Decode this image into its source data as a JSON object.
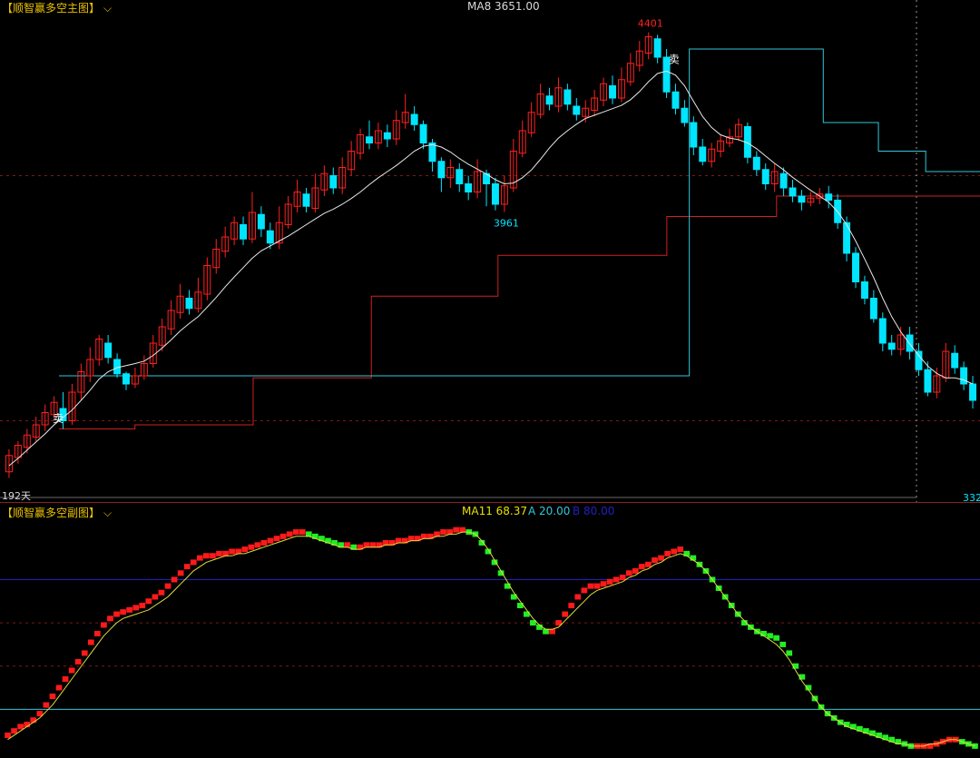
{
  "main": {
    "title": "【顺智赢多空主图】",
    "ma_label": "MA8 3651.00",
    "days_label": "192天",
    "price_high": "4401",
    "price_low": "3961",
    "price_right": "332",
    "sell_marker": "卖"
  },
  "sub": {
    "title": "【顺智赢多空副图】",
    "ma_label": "MA11 68.37",
    "a_label": "A 20.00",
    "b_label": "B 80.00"
  },
  "colors": {
    "up": "#ff2020",
    "down": "#00e5ff",
    "ma": "#e8e8e8",
    "step_red": "#d02020",
    "step_cyan": "#30c8d8",
    "osc_up": "#ff1a1a",
    "osc_down": "#22ee22",
    "osc_ma": "#dcdc40",
    "level_a": "#30c8d8",
    "level_b": "#2020c0",
    "title": "#e8c000"
  },
  "chart_data": [
    {
      "type": "candlestick",
      "ylim": [
        3280,
        4440
      ],
      "candles": [
        [
          3325,
          3365,
          3310,
          3380
        ],
        [
          3360,
          3390,
          3345,
          3400
        ],
        [
          3385,
          3415,
          3370,
          3430
        ],
        [
          3410,
          3440,
          3400,
          3460
        ],
        [
          3440,
          3470,
          3425,
          3490
        ],
        [
          3465,
          3495,
          3455,
          3510
        ],
        [
          3480,
          3450,
          3430,
          3520
        ],
        [
          3450,
          3520,
          3440,
          3540
        ],
        [
          3520,
          3570,
          3500,
          3590
        ],
        [
          3560,
          3600,
          3545,
          3630
        ],
        [
          3600,
          3650,
          3585,
          3660
        ],
        [
          3640,
          3605,
          3590,
          3660
        ],
        [
          3600,
          3565,
          3555,
          3615
        ],
        [
          3565,
          3540,
          3525,
          3570
        ],
        [
          3540,
          3560,
          3530,
          3580
        ],
        [
          3560,
          3590,
          3550,
          3610
        ],
        [
          3590,
          3640,
          3580,
          3660
        ],
        [
          3635,
          3680,
          3620,
          3700
        ],
        [
          3675,
          3720,
          3660,
          3745
        ],
        [
          3715,
          3755,
          3700,
          3785
        ],
        [
          3750,
          3725,
          3710,
          3770
        ],
        [
          3725,
          3765,
          3715,
          3800
        ],
        [
          3760,
          3830,
          3745,
          3850
        ],
        [
          3825,
          3870,
          3810,
          3895
        ],
        [
          3865,
          3900,
          3850,
          3925
        ],
        [
          3895,
          3935,
          3880,
          3950
        ],
        [
          3930,
          3895,
          3880,
          3950
        ],
        [
          3895,
          3960,
          3885,
          4010
        ],
        [
          3955,
          3920,
          3900,
          3975
        ],
        [
          3915,
          3885,
          3870,
          3935
        ],
        [
          3885,
          3935,
          3870,
          3975
        ],
        [
          3930,
          3980,
          3920,
          4000
        ],
        [
          3975,
          4010,
          3960,
          4040
        ],
        [
          4005,
          3975,
          3960,
          4020
        ],
        [
          3970,
          4020,
          3960,
          4055
        ],
        [
          4015,
          4055,
          4000,
          4075
        ],
        [
          4050,
          4020,
          4005,
          4070
        ],
        [
          4020,
          4070,
          4005,
          4095
        ],
        [
          4065,
          4110,
          4050,
          4135
        ],
        [
          4105,
          4150,
          4090,
          4165
        ],
        [
          4145,
          4130,
          4115,
          4185
        ],
        [
          4130,
          4160,
          4115,
          4180
        ],
        [
          4155,
          4140,
          4120,
          4175
        ],
        [
          4140,
          4185,
          4125,
          4210
        ],
        [
          4180,
          4205,
          4165,
          4250
        ],
        [
          4200,
          4175,
          4160,
          4220
        ],
        [
          4175,
          4130,
          4115,
          4185
        ],
        [
          4130,
          4085,
          4060,
          4140
        ],
        [
          4085,
          4045,
          4010,
          4095
        ],
        [
          4045,
          4070,
          4020,
          4090
        ],
        [
          4065,
          4030,
          4010,
          4080
        ],
        [
          4030,
          4010,
          3990,
          4050
        ],
        [
          4010,
          4060,
          3995,
          4090
        ],
        [
          4055,
          4030,
          3975,
          4065
        ],
        [
          4030,
          3980,
          3965,
          4045
        ],
        [
          3980,
          4025,
          3961,
          4050
        ],
        [
          4020,
          4110,
          4010,
          4140
        ],
        [
          4105,
          4160,
          4095,
          4185
        ],
        [
          4155,
          4205,
          4145,
          4230
        ],
        [
          4200,
          4250,
          4190,
          4275
        ],
        [
          4245,
          4225,
          4210,
          4265
        ],
        [
          4220,
          4265,
          4205,
          4290
        ],
        [
          4260,
          4225,
          4210,
          4275
        ],
        [
          4220,
          4200,
          4185,
          4240
        ],
        [
          4195,
          4215,
          4180,
          4235
        ],
        [
          4210,
          4240,
          4195,
          4260
        ],
        [
          4235,
          4275,
          4220,
          4290
        ],
        [
          4270,
          4240,
          4225,
          4295
        ],
        [
          4240,
          4285,
          4230,
          4315
        ],
        [
          4280,
          4325,
          4270,
          4350
        ],
        [
          4320,
          4355,
          4305,
          4380
        ],
        [
          4350,
          4390,
          4335,
          4401
        ],
        [
          4385,
          4340,
          4325,
          4395
        ],
        [
          4340,
          4255,
          4240,
          4360
        ],
        [
          4255,
          4215,
          4200,
          4275
        ],
        [
          4215,
          4180,
          4170,
          4235
        ],
        [
          4180,
          4120,
          4100,
          4195
        ],
        [
          4120,
          4085,
          4075,
          4140
        ],
        [
          4085,
          4115,
          4070,
          4130
        ],
        [
          4110,
          4135,
          4095,
          4150
        ],
        [
          4130,
          4145,
          4120,
          4165
        ],
        [
          4145,
          4175,
          4135,
          4190
        ],
        [
          4170,
          4095,
          4080,
          4180
        ],
        [
          4095,
          4065,
          4050,
          4110
        ],
        [
          4065,
          4030,
          4015,
          4080
        ],
        [
          4030,
          4060,
          4010,
          4080
        ],
        [
          4055,
          4020,
          4000,
          4070
        ],
        [
          4020,
          4000,
          3985,
          4040
        ],
        [
          4000,
          3985,
          3965,
          4015
        ],
        [
          3985,
          3995,
          3975,
          4010
        ],
        [
          3995,
          4005,
          3980,
          4020
        ],
        [
          4005,
          3990,
          3970,
          4025
        ],
        [
          3990,
          3935,
          3920,
          4005
        ],
        [
          3935,
          3860,
          3840,
          3950
        ],
        [
          3860,
          3790,
          3775,
          3875
        ],
        [
          3790,
          3750,
          3735,
          3805
        ],
        [
          3750,
          3700,
          3690,
          3770
        ],
        [
          3700,
          3640,
          3620,
          3715
        ],
        [
          3640,
          3625,
          3610,
          3660
        ],
        [
          3625,
          3660,
          3610,
          3680
        ],
        [
          3660,
          3620,
          3600,
          3680
        ],
        [
          3620,
          3575,
          3560,
          3640
        ],
        [
          3575,
          3520,
          3510,
          3595
        ],
        [
          3520,
          3560,
          3505,
          3580
        ],
        [
          3555,
          3620,
          3545,
          3640
        ],
        [
          3615,
          3580,
          3565,
          3635
        ],
        [
          3580,
          3540,
          3525,
          3595
        ],
        [
          3540,
          3500,
          3480,
          3560
        ]
      ],
      "ma": [
        3340,
        3358,
        3378,
        3398,
        3418,
        3440,
        3458,
        3476,
        3500,
        3525,
        3552,
        3570,
        3580,
        3585,
        3590,
        3596,
        3610,
        3628,
        3648,
        3670,
        3688,
        3705,
        3728,
        3752,
        3778,
        3802,
        3825,
        3848,
        3866,
        3878,
        3890,
        3902,
        3916,
        3930,
        3944,
        3958,
        3968,
        3980,
        3994,
        4010,
        4028,
        4045,
        4060,
        4075,
        4092,
        4110,
        4122,
        4126,
        4120,
        4108,
        4092,
        4078,
        4066,
        4054,
        4040,
        4030,
        4032,
        4045,
        4064,
        4090,
        4118,
        4142,
        4160,
        4176,
        4190,
        4198,
        4206,
        4214,
        4222,
        4236,
        4256,
        4280,
        4300,
        4306,
        4296,
        4270,
        4232,
        4195,
        4168,
        4150,
        4142,
        4138,
        4130,
        4116,
        4098,
        4080,
        4064,
        4046,
        4030,
        4014,
        4000,
        3985,
        3962,
        3930,
        3890,
        3846,
        3800,
        3750,
        3705,
        3668,
        3638,
        3610,
        3584,
        3566,
        3555,
        3555,
        3550,
        3540
      ],
      "support_steps": [
        [
          0,
          3430
        ],
        [
          9,
          3440
        ],
        [
          23,
          3555
        ],
        [
          37,
          3755
        ],
        [
          52,
          3855
        ],
        [
          72,
          3950
        ],
        [
          85,
          4000
        ],
        [
          112,
          4000
        ]
      ],
      "resist_steps": [
        [
          0,
          3560
        ],
        [
          9,
          3560
        ],
        [
          80,
          4360
        ],
        [
          97,
          4180
        ],
        [
          104,
          4110
        ],
        [
          110,
          4060
        ],
        [
          120,
          3900
        ]
      ],
      "annotations": [
        "4401",
        "3961",
        "卖"
      ]
    },
    {
      "type": "bar",
      "ylim": [
        0,
        110
      ],
      "values": [
        8,
        10,
        12,
        13,
        15,
        18,
        22,
        26,
        30,
        34,
        38,
        42,
        46,
        51,
        55,
        59,
        62,
        64,
        65,
        66,
        67,
        68,
        70,
        72,
        74,
        77,
        80,
        83,
        86,
        88,
        90,
        91,
        91,
        92,
        92,
        93,
        93,
        94,
        95,
        96,
        97,
        98,
        99,
        100,
        101,
        102,
        102,
        101,
        100,
        99,
        98,
        97,
        96,
        96,
        95,
        95,
        96,
        96,
        96,
        97,
        97,
        98,
        98,
        99,
        99,
        100,
        100,
        101,
        102,
        102,
        103,
        103,
        102,
        101,
        97,
        93,
        88,
        83,
        77,
        72,
        68,
        64,
        60,
        58,
        56,
        56,
        60,
        64,
        68,
        72,
        75,
        77,
        77,
        78,
        79,
        80,
        81,
        83,
        84,
        86,
        87,
        89,
        90,
        92,
        93,
        94,
        92,
        90,
        87,
        84,
        80,
        76,
        72,
        68,
        64,
        60,
        58,
        56,
        55,
        54,
        53,
        50,
        46,
        40,
        35,
        30,
        25,
        21,
        18,
        16,
        14,
        13,
        12,
        11,
        10,
        9,
        8,
        7,
        6,
        5,
        4,
        3,
        3,
        3,
        3,
        4,
        5,
        6,
        6,
        5,
        4,
        3
      ],
      "ma": [
        6,
        8,
        10,
        12,
        14,
        16,
        19,
        22,
        26,
        30,
        34,
        38,
        42,
        46,
        50,
        54,
        57,
        60,
        62,
        63,
        64,
        65,
        66,
        68,
        70,
        72,
        75,
        78,
        81,
        84,
        86,
        88,
        89,
        90,
        91,
        91,
        92,
        92,
        93,
        94,
        95,
        96,
        97,
        98,
        99,
        100,
        100,
        100,
        99,
        98,
        97,
        96,
        95,
        95,
        94,
        94,
        95,
        95,
        95,
        96,
        96,
        97,
        97,
        98,
        98,
        99,
        99,
        100,
        100,
        101,
        101,
        102,
        102,
        101,
        98,
        94,
        89,
        84,
        79,
        74,
        70,
        66,
        62,
        59,
        57,
        57,
        58,
        61,
        64,
        67,
        70,
        73,
        75,
        76,
        77,
        78,
        79,
        81,
        82,
        84,
        85,
        87,
        88,
        90,
        91,
        92,
        91,
        89,
        87,
        84,
        80,
        76,
        72,
        68,
        64,
        61,
        58,
        56,
        54,
        52,
        50,
        47,
        43,
        38,
        33,
        29,
        25,
        21,
        18,
        16,
        14,
        12,
        11,
        10,
        9,
        8,
        7,
        6,
        5,
        4,
        4,
        3,
        3,
        3,
        4,
        4,
        5,
        6,
        6,
        5,
        4,
        3
      ],
      "levels": {
        "A": 20,
        "B": 80
      }
    }
  ]
}
